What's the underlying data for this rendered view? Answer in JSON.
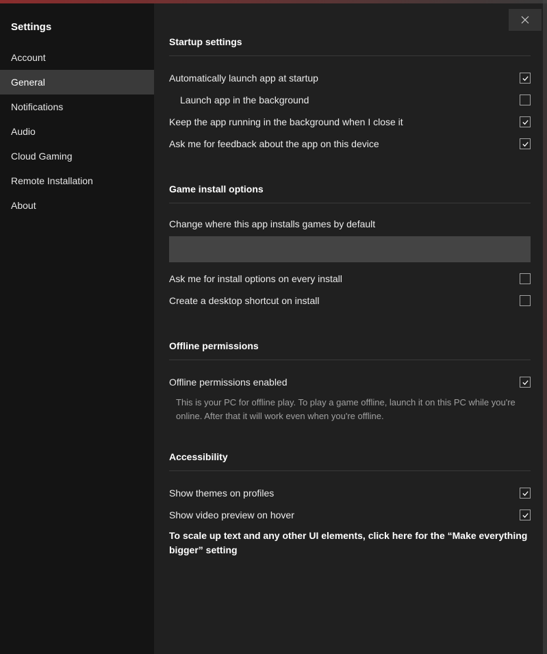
{
  "sidebar": {
    "title": "Settings",
    "items": [
      {
        "label": "Account"
      },
      {
        "label": "General"
      },
      {
        "label": "Notifications"
      },
      {
        "label": "Audio"
      },
      {
        "label": "Cloud Gaming"
      },
      {
        "label": "Remote Installation"
      },
      {
        "label": "About"
      }
    ],
    "activeIndex": 1
  },
  "sections": {
    "startup": {
      "title": "Startup settings",
      "auto_launch": "Automatically launch app at startup",
      "launch_bg": "Launch app in the background",
      "keep_running": "Keep the app running in the background when I close it",
      "feedback": "Ask me for feedback about the app on this device"
    },
    "install": {
      "title": "Game install options",
      "change_location": "Change where this app installs games by default",
      "ask_options": "Ask me for install options on every install",
      "desktop_shortcut": "Create a desktop shortcut on install"
    },
    "offline": {
      "title": "Offline permissions",
      "enabled": "Offline permissions enabled",
      "helper": "This is your PC for offline play. To play a game offline, launch it on this PC while you're online. After that it will work even when you're offline."
    },
    "accessibility": {
      "title": "Accessibility",
      "themes": "Show themes on profiles",
      "video_preview": "Show video preview on hover",
      "scale_link": "To scale up text and any other UI elements, click here for the “Make everything bigger” setting"
    }
  },
  "checkboxes": {
    "auto_launch": true,
    "launch_bg": false,
    "keep_running": true,
    "feedback": true,
    "ask_options": false,
    "desktop_shortcut": false,
    "offline_enabled": true,
    "themes": true,
    "video_preview": true
  }
}
